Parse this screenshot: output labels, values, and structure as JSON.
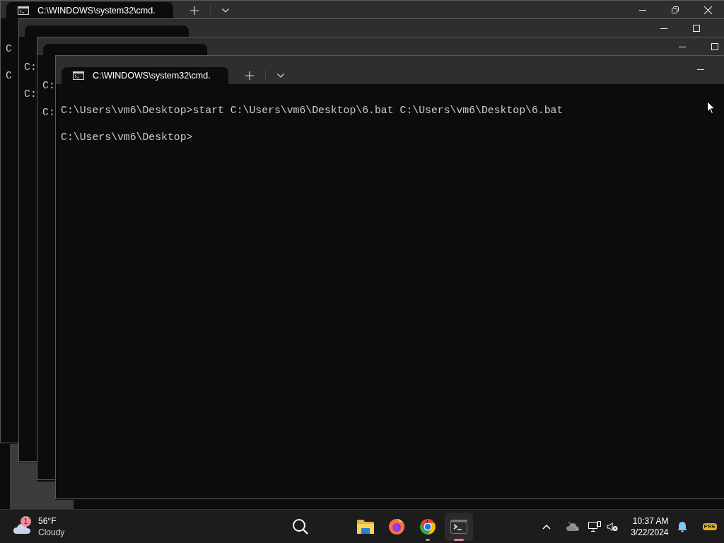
{
  "windows": [
    {
      "title": "C:\\WINDOWS\\system32\\cmd.",
      "maximized": true,
      "lines": [
        "C",
        "C"
      ]
    },
    {
      "maximized": false,
      "lines": [
        "C:",
        "C:"
      ]
    },
    {
      "maximized": false,
      "lines": [
        "C:",
        "C:"
      ]
    },
    {
      "title": "C:\\WINDOWS\\system32\\cmd.",
      "lines": [
        "C:\\Users\\vm6\\Desktop>start C:\\Users\\vm6\\Desktop\\6.bat C:\\Users\\vm6\\Desktop\\6.bat",
        "C:\\Users\\vm6\\Desktop>"
      ]
    }
  ],
  "taskbar": {
    "weather": {
      "badge": "1",
      "temperature": "56°F",
      "condition": "Cloudy"
    },
    "apps": [
      {
        "kind": "files",
        "running": false,
        "active": false
      },
      {
        "kind": "firefox",
        "running": false,
        "active": false
      },
      {
        "kind": "chrome",
        "running": true,
        "active": false
      },
      {
        "kind": "terminal",
        "running": true,
        "active": true
      }
    ],
    "clock": {
      "time": "10:37 AM",
      "date": "3/22/2024"
    },
    "tray_badge": "PRE"
  }
}
